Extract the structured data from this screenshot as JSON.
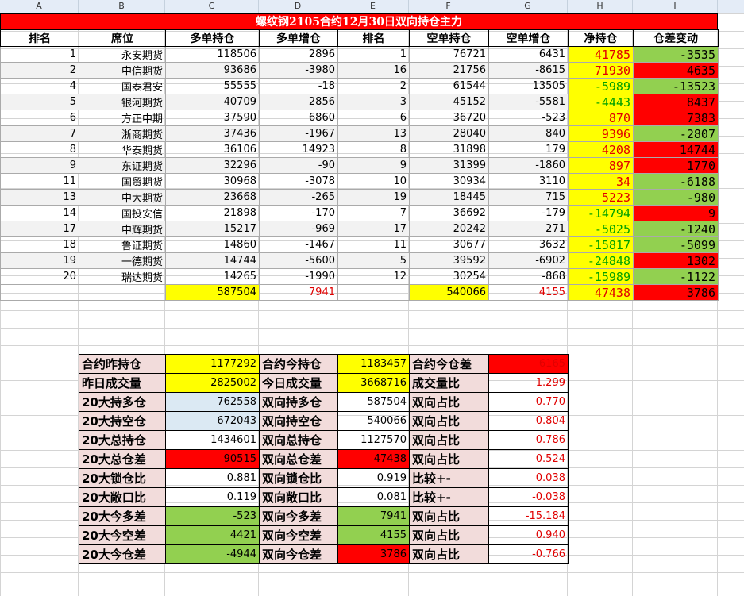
{
  "columns": [
    "A",
    "B",
    "C",
    "D",
    "E",
    "F",
    "G",
    "H",
    "I"
  ],
  "title": "螺纹钢2105合约12月30日双向持仓主力",
  "headers": [
    "排名",
    "席位",
    "多单持仓",
    "多单增仓",
    "排名",
    "空单持仓",
    "空单增仓",
    "净持仓",
    "仓差变动"
  ],
  "rows": [
    {
      "rank": "1",
      "seat": "永安期货",
      "long": "118506",
      "long_chg": "2896",
      "srank": "1",
      "short": "76721",
      "short_chg": "6431",
      "net": "41785",
      "diff": "-3535"
    },
    {
      "rank": "2",
      "seat": "中信期货",
      "long": "93686",
      "long_chg": "-3980",
      "srank": "16",
      "short": "21756",
      "short_chg": "-8615",
      "net": "71930",
      "diff": "4635"
    },
    {
      "rank": "4",
      "seat": "国泰君安",
      "long": "55555",
      "long_chg": "-18",
      "srank": "2",
      "short": "61544",
      "short_chg": "13505",
      "net": "-5989",
      "diff": "-13523"
    },
    {
      "rank": "5",
      "seat": "银河期货",
      "long": "40709",
      "long_chg": "2856",
      "srank": "3",
      "short": "45152",
      "short_chg": "-5581",
      "net": "-4443",
      "diff": "8437"
    },
    {
      "rank": "6",
      "seat": "方正中期",
      "long": "37590",
      "long_chg": "6860",
      "srank": "6",
      "short": "36720",
      "short_chg": "-523",
      "net": "870",
      "diff": "7383"
    },
    {
      "rank": "7",
      "seat": "浙商期货",
      "long": "37436",
      "long_chg": "-1967",
      "srank": "13",
      "short": "28040",
      "short_chg": "840",
      "net": "9396",
      "diff": "-2807"
    },
    {
      "rank": "8",
      "seat": "华泰期货",
      "long": "36106",
      "long_chg": "14923",
      "srank": "8",
      "short": "31898",
      "short_chg": "179",
      "net": "4208",
      "diff": "14744"
    },
    {
      "rank": "9",
      "seat": "东证期货",
      "long": "32296",
      "long_chg": "-90",
      "srank": "9",
      "short": "31399",
      "short_chg": "-1860",
      "net": "897",
      "diff": "1770"
    },
    {
      "rank": "11",
      "seat": "国贸期货",
      "long": "30968",
      "long_chg": "-3078",
      "srank": "10",
      "short": "30934",
      "short_chg": "3110",
      "net": "34",
      "diff": "-6188"
    },
    {
      "rank": "13",
      "seat": "中大期货",
      "long": "23668",
      "long_chg": "-265",
      "srank": "19",
      "short": "18445",
      "short_chg": "715",
      "net": "5223",
      "diff": "-980"
    },
    {
      "rank": "14",
      "seat": "国投安信",
      "long": "21898",
      "long_chg": "-170",
      "srank": "7",
      "short": "36692",
      "short_chg": "-179",
      "net": "-14794",
      "diff": "9"
    },
    {
      "rank": "17",
      "seat": "中辉期货",
      "long": "15217",
      "long_chg": "-969",
      "srank": "17",
      "short": "20242",
      "short_chg": "271",
      "net": "-5025",
      "diff": "-1240"
    },
    {
      "rank": "18",
      "seat": "鲁证期货",
      "long": "14860",
      "long_chg": "-1467",
      "srank": "11",
      "short": "30677",
      "short_chg": "3632",
      "net": "-15817",
      "diff": "-5099"
    },
    {
      "rank": "19",
      "seat": "一德期货",
      "long": "14744",
      "long_chg": "-5600",
      "srank": "5",
      "short": "39592",
      "short_chg": "-6902",
      "net": "-24848",
      "diff": "1302"
    },
    {
      "rank": "20",
      "seat": "瑞达期货",
      "long": "14265",
      "long_chg": "-1990",
      "srank": "12",
      "short": "30254",
      "short_chg": "-868",
      "net": "-15989",
      "diff": "-1122"
    }
  ],
  "totals": {
    "long": "587504",
    "long_chg": "7941",
    "short": "540066",
    "short_chg": "4155",
    "net": "47438",
    "diff": "3786"
  },
  "colors": {
    "yellow": "#ffff00",
    "red": "#ff0000",
    "green": "#92d050",
    "pink": "#f2dcdb",
    "lightblue": "#dbe9f3",
    "text_red": "#e00000",
    "text_green": "#00a000"
  },
  "summary": [
    [
      "合约昨持仓",
      "1177292",
      "合约今持仓",
      "1183457",
      "合约今仓差",
      "6165"
    ],
    [
      "昨日成交量",
      "2825002",
      "今日成交量",
      "3668716",
      "成交量比",
      "1.299"
    ],
    [
      "20大持多仓",
      "762558",
      "双向持多仓",
      "587504",
      "双向占比",
      "0.770"
    ],
    [
      "20大持空仓",
      "672043",
      "双向持空仓",
      "540066",
      "双向占比",
      "0.804"
    ],
    [
      "20大总持仓",
      "1434601",
      "双向总持仓",
      "1127570",
      "双向占比",
      "0.786"
    ],
    [
      "20大总仓差",
      "90515",
      "双向总仓差",
      "47438",
      "双向占比",
      "0.524"
    ],
    [
      "20大锁仓比",
      "0.881",
      "双向锁仓比",
      "0.919",
      "比较+-",
      "0.038"
    ],
    [
      "20大敞口比",
      "0.119",
      "双向敞口比",
      "0.081",
      "比较+-",
      "-0.038"
    ],
    [
      "20大今多差",
      "-523",
      "双向今多差",
      "7941",
      "双向占比",
      "-15.184"
    ],
    [
      "20大今空差",
      "4421",
      "双向今空差",
      "4155",
      "双向占比",
      "0.940"
    ],
    [
      "20大今仓差",
      "-4944",
      "双向今仓差",
      "3786",
      "双向占比",
      "-0.766"
    ]
  ]
}
